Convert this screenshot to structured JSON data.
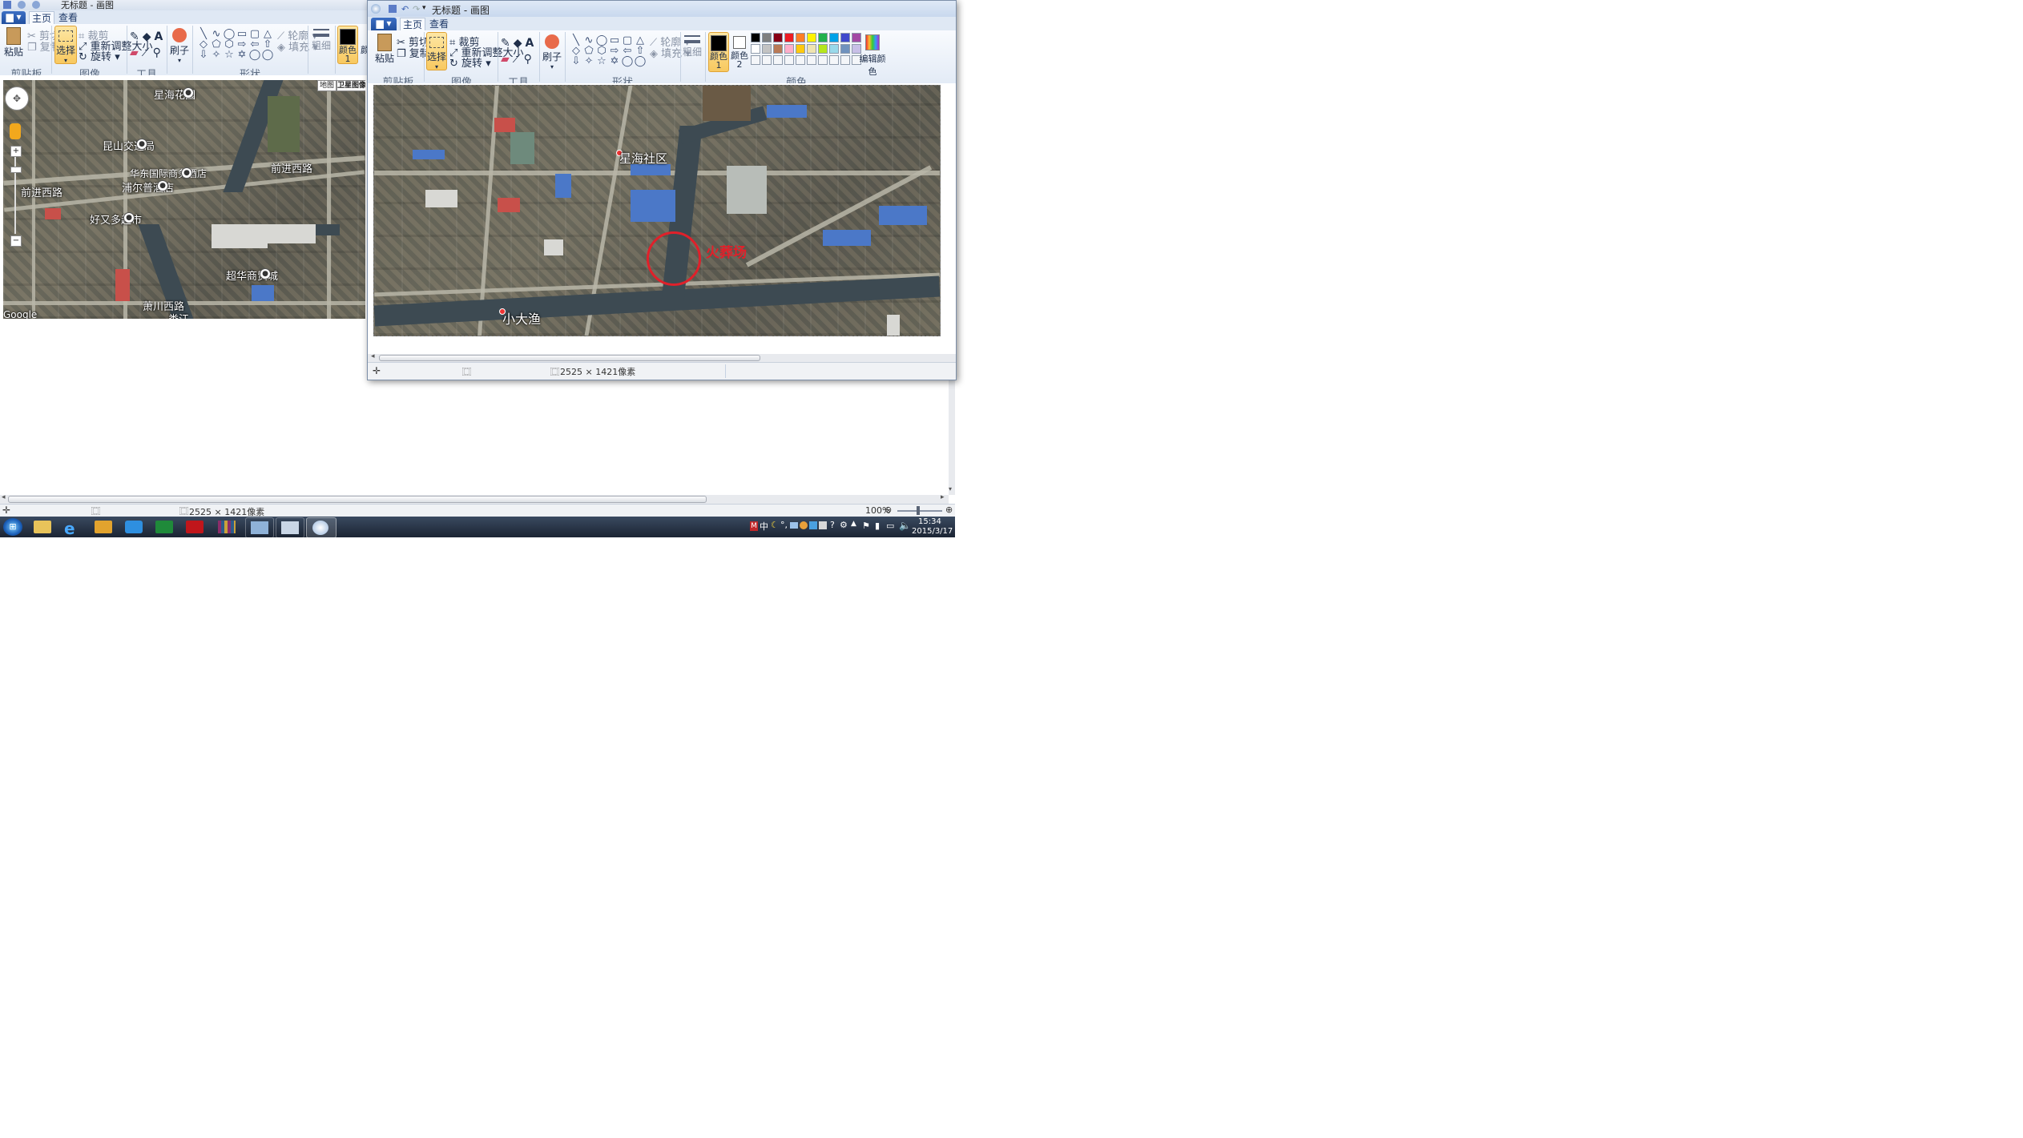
{
  "back_window": {
    "title": "无标题 - 画图",
    "tabs": [
      {
        "label": "主页"
      },
      {
        "label": "查看"
      }
    ],
    "groups": {
      "clipboard": "剪贴板",
      "image": "图像",
      "tools": "工具",
      "shapes": "形状"
    },
    "buttons": {
      "paste": "粘贴",
      "cut": "剪切",
      "copy": "复制",
      "select": "选择",
      "crop": "裁剪",
      "resize": "重新调整大小",
      "rotate": "旋转",
      "brush": "刷子",
      "outline": "轮廓",
      "fill": "填充",
      "size": "粗细",
      "color1": "颜色 1",
      "color2_partial": "颜"
    },
    "map": {
      "toggle_map": "地图",
      "toggle_satellite": "卫星图像",
      "labels": [
        {
          "text": "星海花园"
        },
        {
          "text": "昆山交通局"
        },
        {
          "text": "华东国际商务酒店"
        },
        {
          "text": "前进西路"
        },
        {
          "text": "前进西路"
        },
        {
          "text": "浦尔普酒店"
        },
        {
          "text": "好又多超市"
        },
        {
          "text": "超华商贸城"
        },
        {
          "text": "萧川西路"
        },
        {
          "text": "娄江"
        }
      ],
      "attribution": "Google"
    },
    "status": {
      "dimensions": "2525 × 1421像素",
      "zoom": "100%"
    }
  },
  "front_window": {
    "title": "无标题 - 画图",
    "tabs": [
      {
        "label": "主页"
      },
      {
        "label": "查看"
      }
    ],
    "groups": {
      "clipboard": "剪贴板",
      "image": "图像",
      "tools": "工具",
      "shapes": "形状",
      "colors": "颜色"
    },
    "buttons": {
      "paste": "粘贴",
      "cut": "剪切",
      "copy": "复制",
      "select": "选择",
      "crop": "裁剪",
      "resize": "重新调整大小",
      "rotate": "旋转",
      "brush": "刷子",
      "outline": "轮廓",
      "fill": "填充",
      "size": "粗细",
      "color1": "颜色 1",
      "color2": "颜色 2",
      "edit_colors": "编辑颜色"
    },
    "palette": [
      "#000000",
      "#7f7f7f",
      "#880015",
      "#ed1c24",
      "#ff7f27",
      "#fff200",
      "#22b14c",
      "#00a2e8",
      "#3f48cc",
      "#a349a4",
      "#ffffff",
      "#c3c3c3",
      "#b97a57",
      "#ffaec9",
      "#ffc90e",
      "#efe4b0",
      "#b5e61d",
      "#99d9ea",
      "#7092be",
      "#c8bfe7"
    ],
    "map": {
      "labels": [
        {
          "text": "星海社区"
        },
        {
          "text": "小大渔"
        }
      ],
      "annotation": "火葬场",
      "annotation_color": "#e0202a"
    },
    "status": {
      "dimensions": "2525 × 1421像素"
    }
  },
  "taskbar": {
    "clock_time": "15:34",
    "clock_date": "2015/3/17",
    "tray_ime": "中"
  }
}
